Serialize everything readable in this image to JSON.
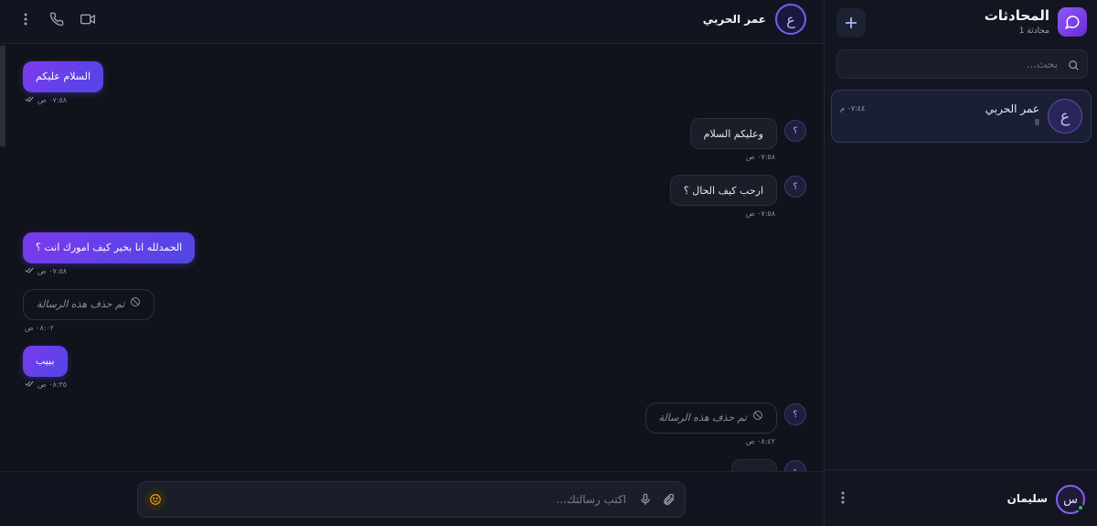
{
  "sidebar": {
    "title": "المحادثات",
    "subtitle": "1 محادثة",
    "search_placeholder": "بحث...",
    "conversations": [
      {
        "initial": "ع",
        "name": "عمر الحربي",
        "last_message": "اا",
        "time": "٠٧:٤٤ م"
      }
    ],
    "current_user": {
      "initial": "س",
      "name": "سليمان",
      "status": "online"
    }
  },
  "chat": {
    "contact": {
      "initial": "ع",
      "name": "عمر الحربي"
    },
    "composer_placeholder": "اكتب رسالتك...",
    "messages": [
      {
        "direction": "out",
        "text": "السلام عليكم",
        "time": "٠٧:٥٨ ص",
        "read": true
      },
      {
        "direction": "in",
        "sender_initial": "؟",
        "text": "وعليكم السلام",
        "time": "٠٧:٥٨ ص"
      },
      {
        "direction": "in",
        "sender_initial": "؟",
        "text": "ارحب كيف الحال ؟",
        "time": "٠٧:٥٨ ص"
      },
      {
        "direction": "out",
        "text": "الحمدلله انا بخير كيف امورك انت ؟",
        "time": "٠٧:٥٨ ص",
        "read": true
      },
      {
        "direction": "out",
        "deleted": true,
        "text": "تم حذف هذه الرسالة",
        "time": "٠٨:٠٢ ص"
      },
      {
        "direction": "out",
        "text": "ببيب",
        "time": "٠٨:٣٥ ص",
        "read": true
      },
      {
        "direction": "in",
        "sender_initial": "؟",
        "deleted": true,
        "text": "تم حذف هذه الرسالة",
        "time": "٠٨:٤٢ ص"
      },
      {
        "direction": "in",
        "sender_initial": "ع",
        "text": ""
      }
    ]
  },
  "colors": {
    "accent": "#7c3aed",
    "accent_2": "#4f46e5",
    "background": "#10131b",
    "online": "#22c55e"
  }
}
